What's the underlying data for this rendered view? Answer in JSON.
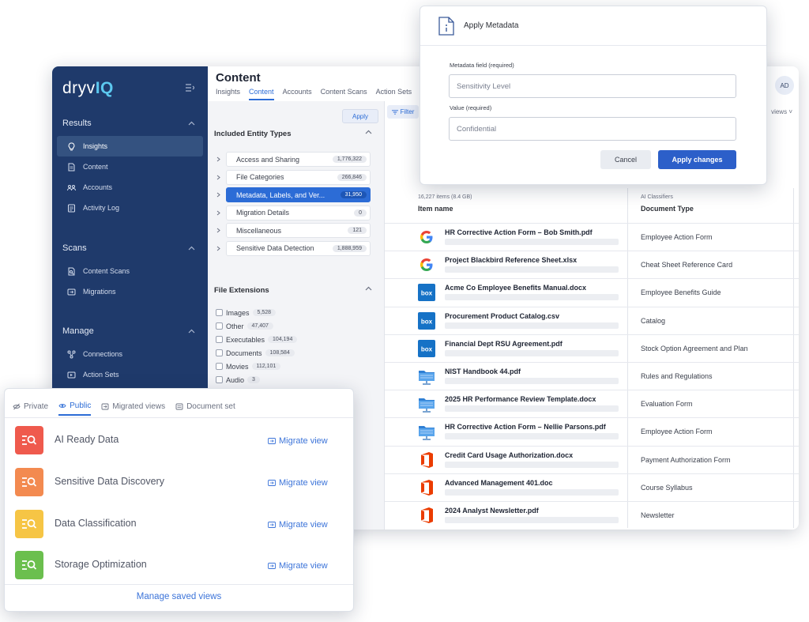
{
  "app": {
    "logo_prefix": "dryv",
    "logo_suffix": "IQ",
    "page_title": "Content",
    "user_initials": "AD"
  },
  "sidebar": {
    "sections": [
      {
        "heading": "Results",
        "items": [
          {
            "label": "Insights",
            "icon": "lightbulb-icon",
            "active": true
          },
          {
            "label": "Content",
            "icon": "document-icon",
            "active": false
          },
          {
            "label": "Accounts",
            "icon": "users-icon",
            "active": false
          },
          {
            "label": "Activity Log",
            "icon": "log-icon",
            "active": false
          }
        ]
      },
      {
        "heading": "Scans",
        "items": [
          {
            "label": "Content Scans",
            "icon": "scan-icon",
            "active": false
          },
          {
            "label": "Migrations",
            "icon": "migration-icon",
            "active": false
          }
        ]
      },
      {
        "heading": "Manage",
        "items": [
          {
            "label": "Connections",
            "icon": "connections-icon",
            "active": false
          },
          {
            "label": "Action Sets",
            "icon": "action-set-icon",
            "active": false
          }
        ]
      }
    ]
  },
  "top_tabs": [
    "Insights",
    "Content",
    "Accounts",
    "Content Scans",
    "Action Sets"
  ],
  "active_top_tab": "Content",
  "filters": {
    "apply_label": "Apply",
    "entity_heading": "Included Entity Types",
    "entity_types": [
      {
        "label": "Access and Sharing",
        "count": "1,776,322",
        "selected": false
      },
      {
        "label": "File Categories",
        "count": "266,846",
        "selected": false
      },
      {
        "label": "Metadata, Labels, and Ver...",
        "count": "31,950",
        "selected": true
      },
      {
        "label": "Migration Details",
        "count": "0",
        "selected": false
      },
      {
        "label": "Miscellaneous",
        "count": "121",
        "selected": false
      },
      {
        "label": "Sensitive Data Detection",
        "count": "1,888,959",
        "selected": false
      }
    ],
    "ext_heading": "File Extensions",
    "extensions": [
      {
        "label": "Images",
        "count": "5,528"
      },
      {
        "label": "Other",
        "count": "47,407"
      },
      {
        "label": "Executables",
        "count": "104,194"
      },
      {
        "label": "Documents",
        "count": "108,584"
      },
      {
        "label": "Movies",
        "count": "112,101"
      },
      {
        "label": "Audio",
        "count": "3"
      }
    ]
  },
  "results": {
    "filter_label": "Filter",
    "views_label": "views",
    "items_count": "16,227 items (8.4 GB)",
    "col_item": "Item name",
    "col_group": "AI Classifiers",
    "col_doctype": "Document Type",
    "rows": [
      {
        "source": "google",
        "name": "HR Corrective Action Form – Bob Smith.pdf",
        "doc_type": "Employee Action Form"
      },
      {
        "source": "google",
        "name": "Project Blackbird Reference Sheet.xlsx",
        "doc_type": "Cheat Sheet Reference Card"
      },
      {
        "source": "box",
        "name": "Acme Co Employee Benefits Manual.docx",
        "doc_type": "Employee Benefits Guide"
      },
      {
        "source": "box",
        "name": "Procurement Product Catalog.csv",
        "doc_type": "Catalog"
      },
      {
        "source": "box",
        "name": "Financial Dept RSU Agreement.pdf",
        "doc_type": "Stock Option Agreement and Plan"
      },
      {
        "source": "share",
        "name": "NIST Handbook 44.pdf",
        "doc_type": "Rules and Regulations"
      },
      {
        "source": "share",
        "name": "2025 HR Performance Review Template.docx",
        "doc_type": "Evaluation Form"
      },
      {
        "source": "share",
        "name": "HR Corrective Action Form – Nellie Parsons.pdf",
        "doc_type": "Employee Action Form"
      },
      {
        "source": "office",
        "name": "Credit Card Usage Authorization.docx",
        "doc_type": "Payment Authorization Form"
      },
      {
        "source": "office",
        "name": "Advanced Management 401.doc",
        "doc_type": "Course Syllabus"
      },
      {
        "source": "office",
        "name": "2024 Analyst Newsletter.pdf",
        "doc_type": "Newsletter"
      }
    ],
    "box_logo_text": "box"
  },
  "modal": {
    "title": "Apply Metadata",
    "field_label": "Metadata field (required)",
    "field_value": "Sensitivity Level",
    "value_label": "Value (required)",
    "value_value": "Confidential",
    "cancel_label": "Cancel",
    "apply_label": "Apply changes"
  },
  "saved_views": {
    "tabs": [
      {
        "label": "Private",
        "icon": "eye-off-icon",
        "active": false
      },
      {
        "label": "Public",
        "icon": "eye-icon",
        "active": true
      },
      {
        "label": "Migrated views",
        "icon": "migrated-icon",
        "active": false
      },
      {
        "label": "Document set",
        "icon": "document-set-icon",
        "active": false
      }
    ],
    "views": [
      {
        "name": "AI Ready Data",
        "color": "#ef5a4d"
      },
      {
        "name": "Sensitive Data Discovery",
        "color": "#f38a50"
      },
      {
        "name": "Data Classification",
        "color": "#f6c545"
      },
      {
        "name": "Storage Optimization",
        "color": "#6bbf4e"
      }
    ],
    "migrate_label": "Migrate view",
    "manage_label": "Manage saved views"
  },
  "colors": {
    "sidebar_bg": "#1f3a6b",
    "accent": "#2c6cd6",
    "primary_button": "#2c5fc9"
  }
}
